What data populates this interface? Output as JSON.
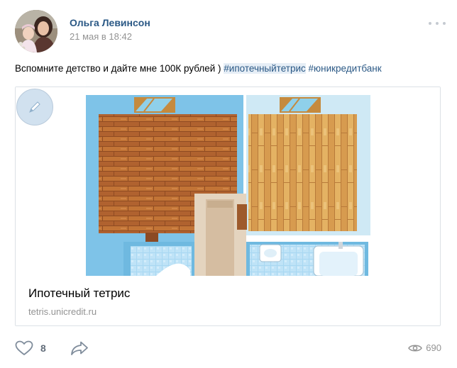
{
  "post": {
    "author": "Ольга Левинсон",
    "date": "21 мая в 18:42",
    "text_prefix": "Вспомните детство и дайте мне 100К рублей ) ",
    "hashtags": [
      "#ипотечныйтетрис",
      "#юникредитбанк"
    ]
  },
  "link_card": {
    "title": "Ипотечный тетрис",
    "domain": "tetris.unicredit.ru"
  },
  "footer": {
    "likes": "8",
    "views": "690"
  },
  "icons": {
    "more": "more-dots-icon",
    "like": "heart-icon",
    "share": "share-arrow-icon",
    "views": "eye-icon",
    "pen": "pen-icon"
  },
  "colors": {
    "link": "#2a5885",
    "muted": "#939393",
    "icon": "#7f8c9b"
  }
}
